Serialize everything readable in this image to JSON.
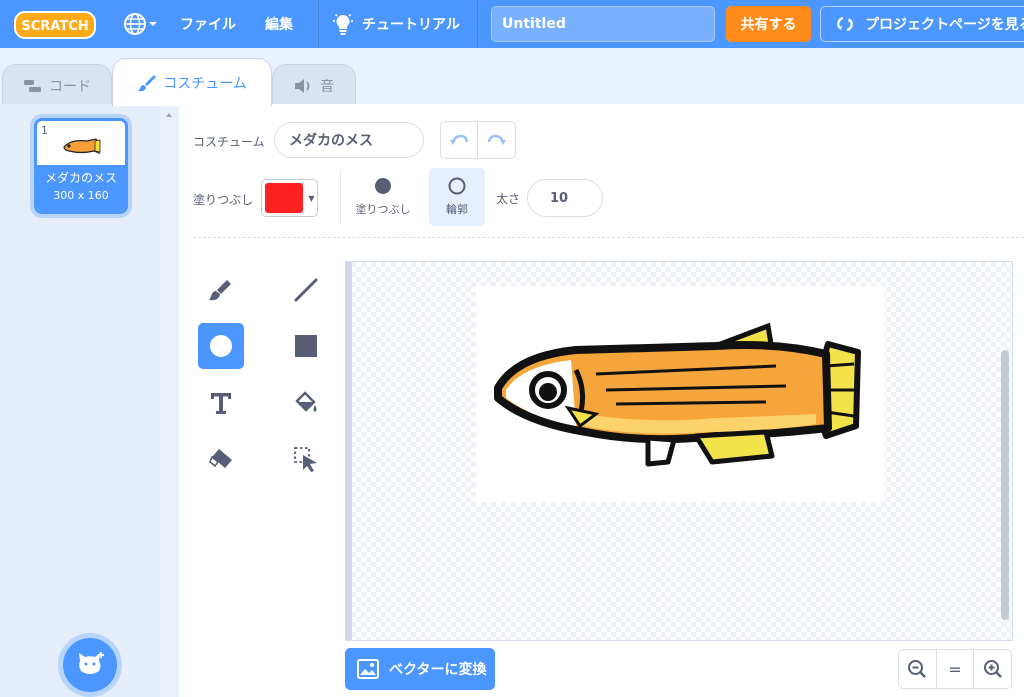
{
  "menu": {
    "logo_text": "SCRATCH",
    "file": "ファイル",
    "edit": "編集",
    "tutorials": "チュートリアル",
    "title_value": "Untitled",
    "share": "共有する",
    "project_page": "プロジェクトページを見る"
  },
  "tabs": {
    "code": "コード",
    "costumes": "コスチューム",
    "sounds": "音"
  },
  "costume_list": [
    {
      "number": "1",
      "name": "メダカのメス",
      "size": "300 x 160"
    }
  ],
  "editor": {
    "costume_label": "コスチューム",
    "costume_name": "メダカのメス",
    "fill_label": "塗りつぶし",
    "fill_color": "#ff2020",
    "mode_fill": "塗りつぶし",
    "mode_outline": "輪郭",
    "thickness_label": "太さ",
    "thickness_value": "10",
    "convert_button": "ベクターに変換",
    "zoom_reset": "="
  },
  "colors": {
    "accent": "#4c97ff",
    "share": "#ff8c1a"
  }
}
